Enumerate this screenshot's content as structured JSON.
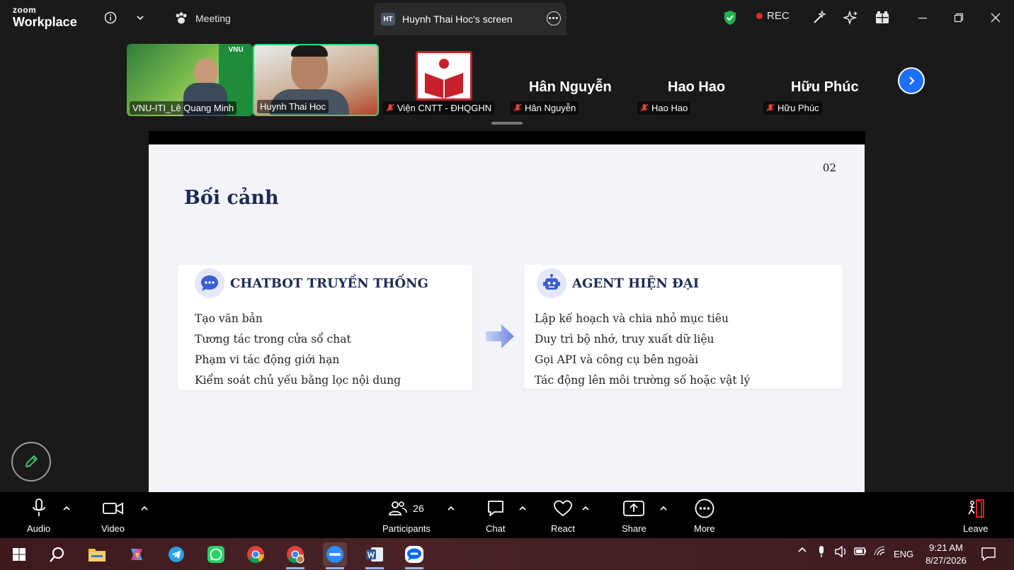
{
  "window": {
    "brand_top": "zoom",
    "brand_bottom": "Workplace",
    "meeting_tab": "Meeting",
    "screen_tab_badge": "HT",
    "screen_tab_title": "Huynh Thai Hoc's screen",
    "rec_label": "REC"
  },
  "gallery": {
    "tiles": [
      {
        "label": "VNU-ITI_Lê Quang Minh"
      },
      {
        "label": "Huynh Thai Hoc"
      },
      {
        "label": "Viện CNTT - ĐHQGHN"
      }
    ],
    "names": [
      {
        "big": "Hân Nguyễn",
        "label": "Hân Nguyễn"
      },
      {
        "big": "Hao Hao",
        "label": "Hao Hao"
      },
      {
        "big": "Hữu Phúc",
        "label": "Hữu Phúc"
      }
    ],
    "tile_banner": "VNU"
  },
  "slide": {
    "number": "02",
    "title": "Bối cảnh",
    "left_card": {
      "title": "CHATBOT TRUYỀN THỐNG",
      "items": [
        "Tạo văn bản",
        "Tương tác trong cửa sổ chat",
        "Phạm vi tác động giới hạn",
        "Kiểm soát chủ yếu bằng lọc nội dung"
      ]
    },
    "right_card": {
      "title": "AGENT HIỆN ĐẠI",
      "items": [
        "Lập kế hoạch và chia nhỏ mục tiêu",
        "Duy trì bộ nhớ, truy xuất dữ liệu",
        "Gọi API và công cụ bên ngoài",
        "Tác động lên môi trường số hoặc vật lý"
      ]
    }
  },
  "toolbar": {
    "audio": "Audio",
    "video": "Video",
    "participants": "Participants",
    "participants_count": "26",
    "chat": "Chat",
    "react": "React",
    "share": "Share",
    "more": "More",
    "leave": "Leave"
  },
  "taskbar": {
    "language": "ENG",
    "time": "9:21 AM",
    "date": "8/27/2026"
  },
  "colors": {
    "accent_blue": "#1f6fff",
    "active_speaker_border": "#3fd07a",
    "slide_title": "#1d2a55",
    "rec_dot": "#e02828"
  }
}
